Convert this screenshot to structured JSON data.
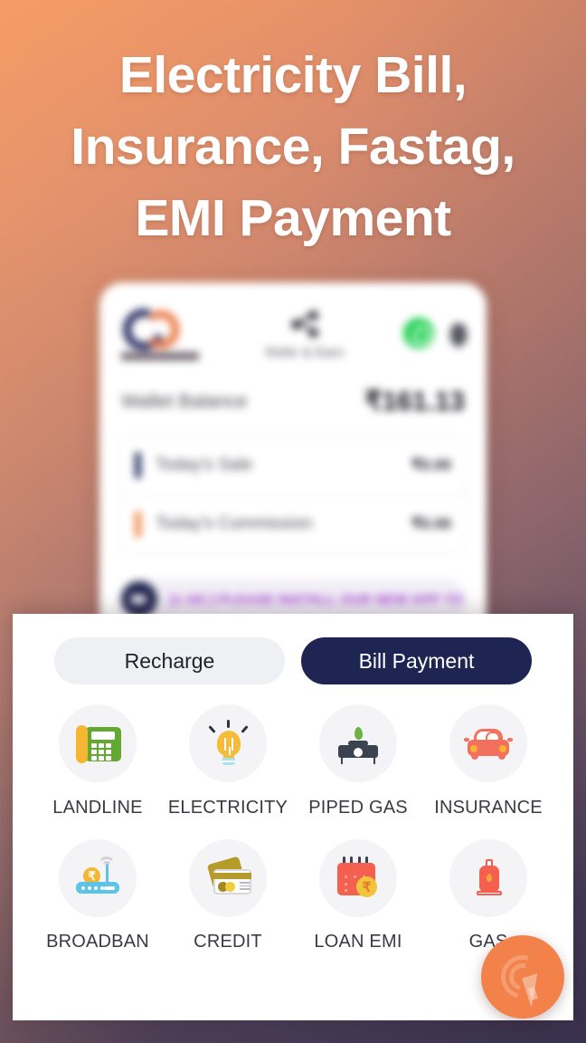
{
  "headline": "Electricity Bill, Insurance, Fastag, EMI Payment",
  "headline_lines": [
    "Electricity Bill,",
    "Insurance, Fastag,",
    "EMI Payment"
  ],
  "colors": {
    "bg_top": "#f59a66",
    "bg_bottom": "#37304c",
    "active_tab": "#1e2552",
    "inactive_tab": "#eef0f3",
    "icon_circle": "#f4f4f7",
    "fab": "#f2814a",
    "marquee_text": "#a845d6"
  },
  "phone_preview": {
    "header": {
      "logo_alt": "app-logo",
      "refer_label": "Refer & Earn",
      "share_icon": "share-icon",
      "whatsapp_icon": "whatsapp-icon",
      "bell_icon": "notification-bell-icon"
    },
    "wallet": {
      "label": "Wallet Balance",
      "amount": "₹161.13"
    },
    "stats": [
      {
        "label": "Today's Sale",
        "value": "₹0.00",
        "bar_color": "#2b3064"
      },
      {
        "label": "Today's Commission",
        "value": "₹0.00",
        "bar_color": "#f08a4b"
      }
    ],
    "marquee": {
      "icon": "megaphone-icon",
      "text": "[x AE.] PLEASE INSTALL OUR NEW APP TO"
    }
  },
  "tabs": [
    {
      "label": "Recharge",
      "active": false
    },
    {
      "label": "Bill Payment",
      "active": true
    }
  ],
  "services": [
    {
      "label": "LANDLINE",
      "icon": "landline-phone-icon"
    },
    {
      "label": "ELECTRICITY",
      "icon": "light-bulb-icon"
    },
    {
      "label": "PIPED GAS",
      "icon": "gas-stove-icon"
    },
    {
      "label": "INSURANCE",
      "icon": "car-icon"
    },
    {
      "label": "BROADBAN",
      "icon": "wifi-router-icon"
    },
    {
      "label": "CREDIT",
      "icon": "credit-card-icon"
    },
    {
      "label": "LOAN EMI",
      "icon": "calendar-rupee-icon"
    },
    {
      "label": "GAS",
      "icon": "gas-cylinder-icon"
    }
  ],
  "fab": {
    "icon": "tap-cursor-icon",
    "label": ""
  },
  "currency_symbol": "₹"
}
